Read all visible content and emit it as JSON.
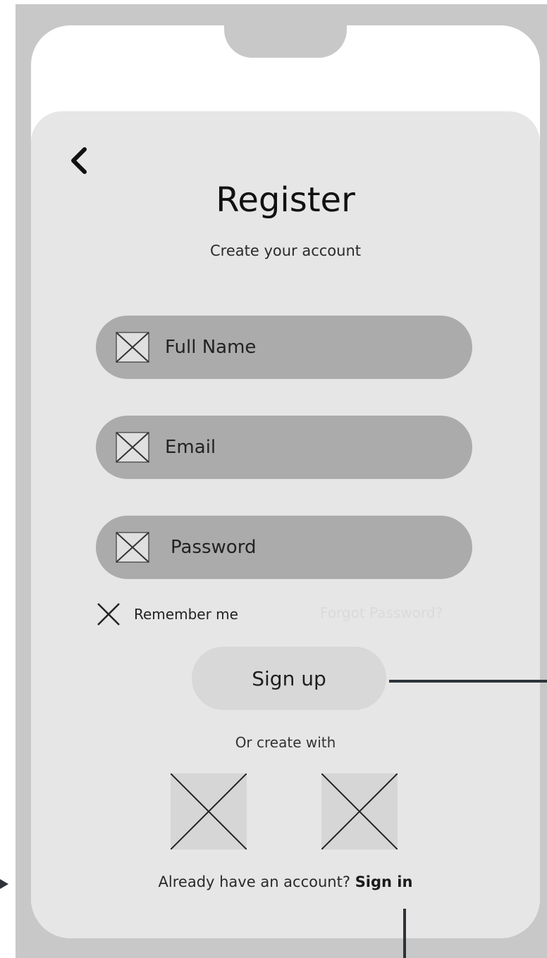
{
  "header": {
    "title": "Register",
    "subtitle": "Create your account"
  },
  "form": {
    "fields": [
      {
        "label": "Full Name",
        "icon": "placeholder-image-icon"
      },
      {
        "label": "Email",
        "icon": "placeholder-image-icon"
      },
      {
        "label": "Password",
        "icon": "placeholder-image-icon"
      }
    ],
    "remember_label": "Remember me",
    "forgot_label": "Forgot Password?",
    "signup_label": "Sign up"
  },
  "social": {
    "divider_text": "Or create with"
  },
  "footer": {
    "prompt": "Already have an account?",
    "signin_label": "Sign in"
  },
  "colors": {
    "frame": "#c8c8c8",
    "sheet": "#e6e6e6",
    "field": "#ababab",
    "button": "#d8d8d8",
    "connector": "#2d3339"
  }
}
